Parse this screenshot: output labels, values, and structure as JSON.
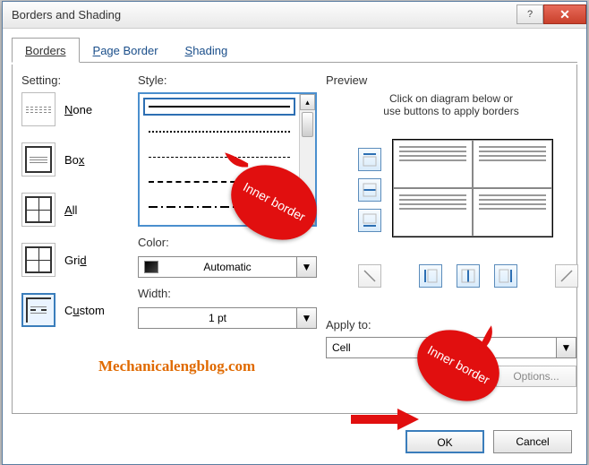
{
  "window": {
    "title": "Borders and Shading"
  },
  "tabs": {
    "borders": "Borders",
    "page_border": "Page Border",
    "shading": "Shading"
  },
  "labels": {
    "setting": "Setting:",
    "style": "Style:",
    "color": "Color:",
    "width": "Width:",
    "preview": "Preview",
    "preview_hint_1": "Click on diagram below or",
    "preview_hint_2": "use buttons to apply borders",
    "apply_to": "Apply to:",
    "options": "Options..."
  },
  "settings": {
    "none": "None",
    "box": "Box",
    "all": "All",
    "grid": "Grid",
    "custom": "Custom"
  },
  "color_dropdown": {
    "value": "Automatic"
  },
  "width_dropdown": {
    "value": "1 pt"
  },
  "apply_to_dropdown": {
    "value": "Cell"
  },
  "buttons": {
    "ok": "OK",
    "cancel": "Cancel"
  },
  "annotations": {
    "callout1": "Inner border",
    "callout2": "Inner border",
    "watermark": "Mechanicalengblog.com"
  }
}
